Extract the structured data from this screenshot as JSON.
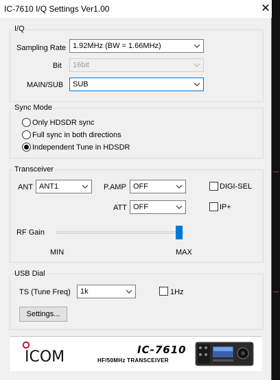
{
  "window": {
    "title": "IC-7610 I/Q Settings   Ver1.00",
    "close_glyph": "✕"
  },
  "iq": {
    "legend": "I/Q",
    "sampling_rate": {
      "label": "Sampling Rate",
      "value": "1.92MHz (BW = 1.66MHz)"
    },
    "bit": {
      "label": "Bit",
      "value": "16bit"
    },
    "main_sub": {
      "label": "MAIN/SUB",
      "value": "SUB"
    }
  },
  "sync_mode": {
    "legend": "Sync Mode",
    "options": [
      {
        "label": "Only HDSDR sync",
        "selected": false
      },
      {
        "label": "Full sync in both directions",
        "selected": false
      },
      {
        "label": "Independent Tune in HDSDR",
        "selected": true
      }
    ]
  },
  "transceiver": {
    "legend": "Transceiver",
    "ant": {
      "label": "ANT",
      "value": "ANT1"
    },
    "pamp": {
      "label": "P.AMP",
      "value": "OFF"
    },
    "att": {
      "label": "ATT",
      "value": "OFF"
    },
    "digi_sel": {
      "label": "DIGI-SEL",
      "checked": false
    },
    "ip_plus": {
      "label": "IP+",
      "checked": false
    },
    "rf_gain": {
      "label": "RF Gain",
      "min_label": "MIN",
      "max_label": "MAX",
      "level": 1.0
    }
  },
  "usb_dial": {
    "legend": "USB Dial",
    "ts": {
      "label": "TS (Tune Freq)",
      "value": "1k"
    },
    "one_hz": {
      "label": "1Hz",
      "checked": false
    },
    "settings_button": "Settings..."
  },
  "brand": {
    "logo": "ICOM",
    "model": "IC-7610",
    "tagline": "HF/50MHz TRANSCEIVER"
  },
  "colors": {
    "accent": "#0078d7",
    "logo_red": "#c8102e"
  }
}
